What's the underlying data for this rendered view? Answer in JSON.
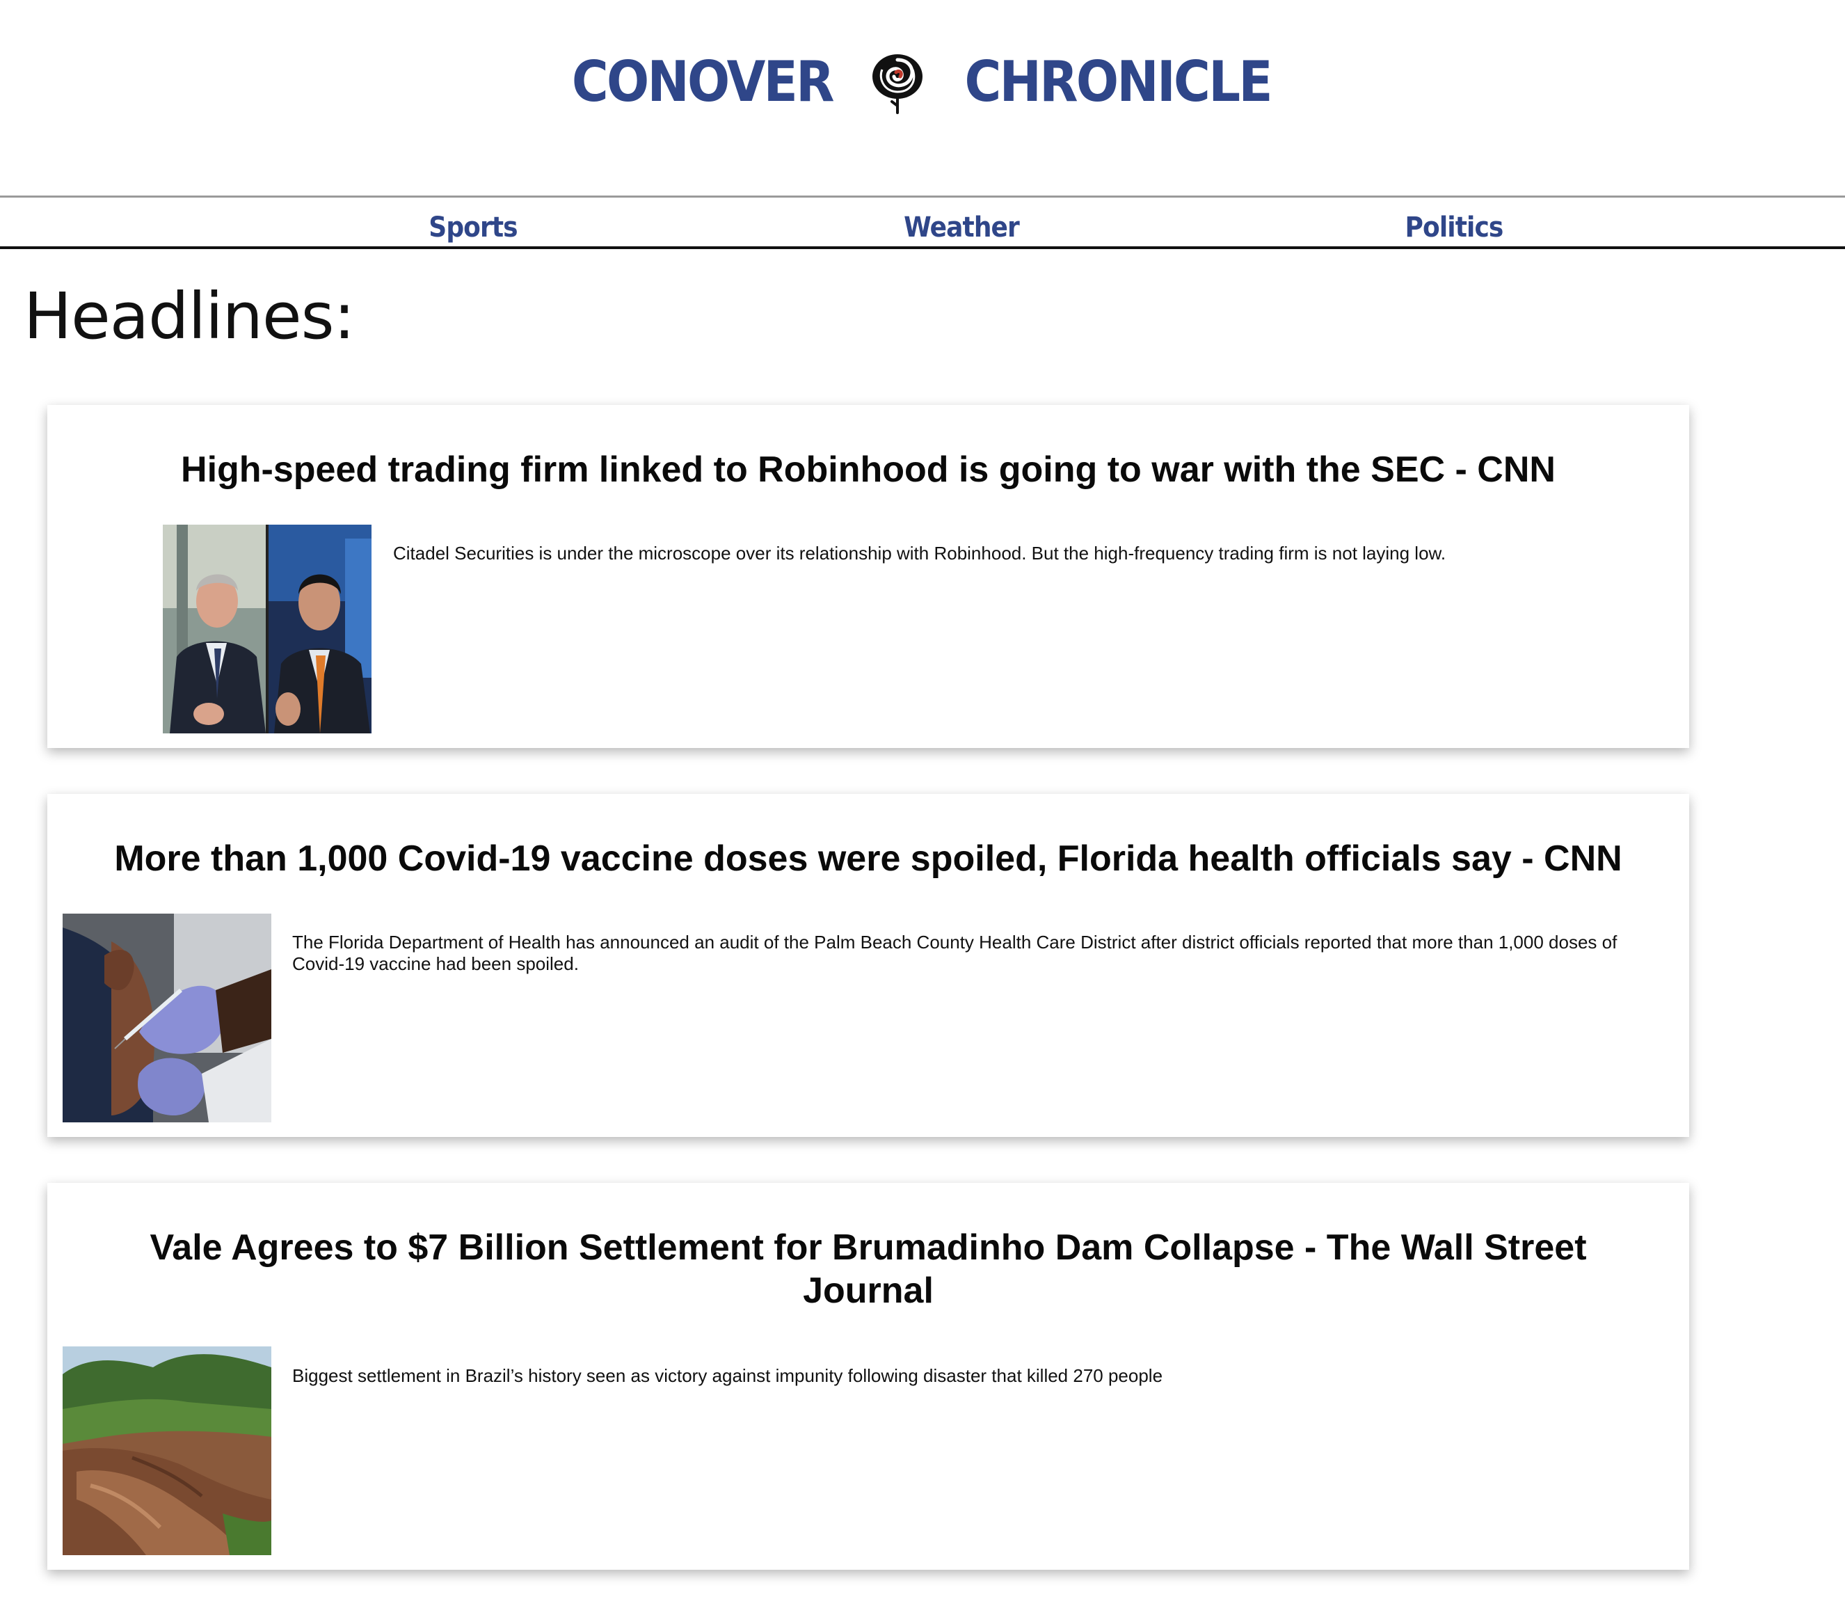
{
  "masthead": {
    "name_left": "CONOVER",
    "name_right": "CHRONICLE",
    "logo": "rose-logo",
    "brand_color": "#2f4689"
  },
  "nav": {
    "items": [
      {
        "label": "Sports"
      },
      {
        "label": "Weather"
      },
      {
        "label": "Politics"
      }
    ]
  },
  "headlines": {
    "title": "Headlines:",
    "articles": [
      {
        "title": "High-speed trading firm linked to Robinhood is going to war with the SEC - CNN",
        "summary": "Citadel Securities is under the microscope over its relationship with Robinhood. But the high-frequency trading firm is not laying low.",
        "image": "two-businessmen-photo"
      },
      {
        "title": "More than 1,000 Covid-19 vaccine doses were spoiled, Florida health officials say - CNN",
        "summary": "The Florida Department of Health has announced an audit of the Palm Beach County Health Care District after district officials reported that more than 1,000 doses of Covid-19 vaccine had been spoiled.",
        "image": "vaccine-injection-photo"
      },
      {
        "title": "Vale Agrees to $7 Billion Settlement for Brumadinho Dam Collapse - The Wall Street Journal",
        "summary": "Biggest settlement in Brazil’s history seen as victory against impunity following disaster that killed 270 people",
        "image": "dam-collapse-aerial-photo"
      }
    ]
  }
}
